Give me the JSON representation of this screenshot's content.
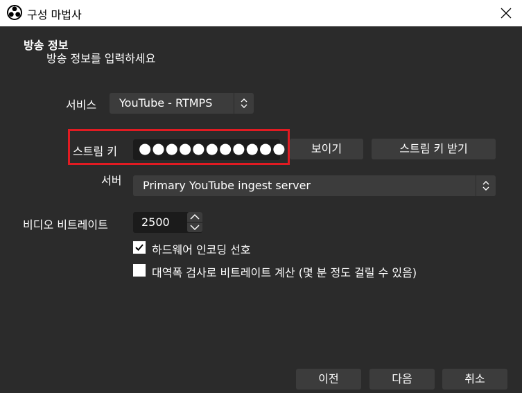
{
  "window": {
    "title": "구성 마법사",
    "logo_icon": "obs-logo-icon",
    "close_icon": "close-icon"
  },
  "page": {
    "title": "방송 정보",
    "subtitle": "방송 정보를 입력하세요"
  },
  "service": {
    "label": "서비스",
    "value": "YouTube - RTMPS"
  },
  "stream_key": {
    "label": "스트림 키",
    "masked_value": "●●●●●●●●●●●",
    "show_button": "보이기",
    "get_key_button": "스트림 키 받기",
    "highlight_color": "#e11b22"
  },
  "server": {
    "label": "서버",
    "value": "Primary YouTube ingest server"
  },
  "bitrate": {
    "label": "비디오 비트레이트",
    "value": "2500"
  },
  "options": {
    "hardware_encoding": {
      "label": "하드웨어 인코딩 선호",
      "checked": true
    },
    "bandwidth_test": {
      "label": "대역폭 검사로 비트레이트 계산 (몇 분 정도 걸릴 수 있음)",
      "checked": false
    }
  },
  "footer": {
    "back_button": "이전",
    "next_button": "다음",
    "cancel_button": "취소"
  },
  "colors": {
    "background": "#2b2b2b",
    "control": "#3c3c3c",
    "input": "#1b1b1b",
    "titlebar": "#ffffff"
  }
}
